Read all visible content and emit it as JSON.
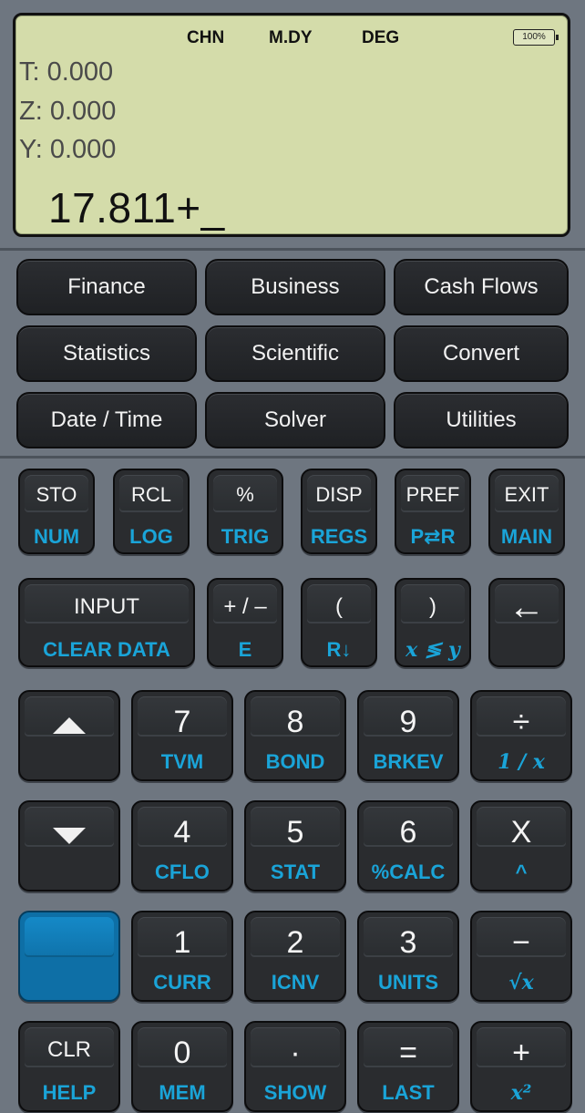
{
  "display": {
    "status": [
      "CHN",
      "M.DY",
      "DEG"
    ],
    "battery": "100%",
    "stack": {
      "t": "T: 0.000",
      "z": "Z: 0.000",
      "y": "Y: 0.000"
    },
    "entry": "17.811+_"
  },
  "menu": [
    [
      "Finance",
      "Business",
      "Cash Flows"
    ],
    [
      "Statistics",
      "Scientific",
      "Convert"
    ],
    [
      "Date / Time",
      "Solver",
      "Utilities"
    ]
  ],
  "keys": {
    "row1": [
      {
        "main": "STO",
        "shift": "NUM"
      },
      {
        "main": "RCL",
        "shift": "LOG"
      },
      {
        "main": "%",
        "shift": "TRIG"
      },
      {
        "main": "DISP",
        "shift": "REGS"
      },
      {
        "main": "PREF",
        "shift": "P⇄R"
      },
      {
        "main": "EXIT",
        "shift": "MAIN"
      }
    ],
    "row2": [
      {
        "main": "INPUT",
        "shift": "CLEAR  DATA"
      },
      {
        "main": "+ / –",
        "shift": "E"
      },
      {
        "main": "(",
        "shift": "R↓"
      },
      {
        "main": ")",
        "shift": "x ≶ y"
      },
      {
        "main": "←",
        "shift": ""
      }
    ],
    "row3": [
      {
        "main": "",
        "shift": ""
      },
      {
        "main": "7",
        "shift": "TVM"
      },
      {
        "main": "8",
        "shift": "BOND"
      },
      {
        "main": "9",
        "shift": "BRKEV"
      },
      {
        "main": "÷",
        "shift": "1 / x"
      }
    ],
    "row4": [
      {
        "main": "",
        "shift": ""
      },
      {
        "main": "4",
        "shift": "CFLO"
      },
      {
        "main": "5",
        "shift": "STAT"
      },
      {
        "main": "6",
        "shift": "%CALC"
      },
      {
        "main": "X",
        "shift": "^"
      }
    ],
    "row5": [
      {
        "main": "",
        "shift": ""
      },
      {
        "main": "1",
        "shift": "CURR"
      },
      {
        "main": "2",
        "shift": "ICNV"
      },
      {
        "main": "3",
        "shift": "UNITS"
      },
      {
        "main": "−",
        "shift": "√x"
      }
    ],
    "row6": [
      {
        "main": "CLR",
        "shift": "HELP"
      },
      {
        "main": "0",
        "shift": "MEM"
      },
      {
        "main": "·",
        "shift": "SHOW"
      },
      {
        "main": "=",
        "shift": "LAST"
      },
      {
        "main": "+",
        "shift": "x²"
      }
    ]
  },
  "icons": {
    "up": "triangle-up-icon",
    "down": "triangle-down-icon",
    "backspace": "arrow-left-icon"
  },
  "colors": {
    "lcd": "#d4dcaa",
    "shift_label": "#1aa4d8",
    "shift_key": "#0e6fa6"
  }
}
